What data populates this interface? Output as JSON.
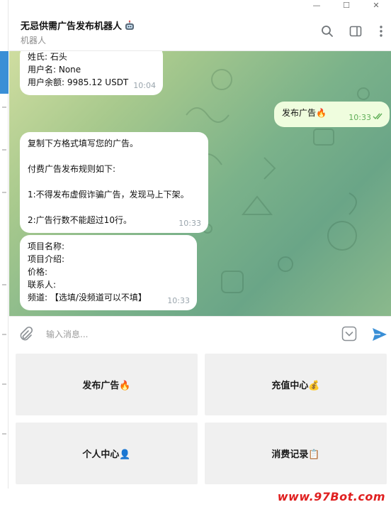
{
  "window": {
    "minimize": "—",
    "maximize": "☐",
    "close": "✕"
  },
  "header": {
    "title": "无忌供需广告发布机器人",
    "subtitle": "机器人",
    "icons": [
      "search-icon",
      "sidebar-toggle-icon",
      "more-vert-icon"
    ]
  },
  "messages": [
    {
      "dir": "in",
      "lines": [
        "姓氏: 石头",
        "用户名: None",
        "用户余额: 9985.12 USDT"
      ],
      "time": "10:04"
    },
    {
      "dir": "out",
      "lines": [
        "发布广告🔥"
      ],
      "time": "10:33"
    },
    {
      "dir": "in",
      "lines": [
        "复制下方格式填写您的广告。",
        "",
        "付费广告发布规则如下:",
        "",
        "1:不得发布虚假诈骗广告，发现马上下架。",
        "",
        "2:广告行数不能超过10行。"
      ],
      "time": "10:33"
    },
    {
      "dir": "in",
      "lines": [
        "项目名称:",
        "项目介绍:",
        "价格:",
        "联系人:",
        "频道: 【选填/没频道可以不填】"
      ],
      "time": "10:33"
    }
  ],
  "input": {
    "placeholder": "输入消息..."
  },
  "keyboard": [
    {
      "label": "发布广告🔥"
    },
    {
      "label": "充值中心💰"
    },
    {
      "label": "个人中心👤"
    },
    {
      "label": "消费记录📋"
    }
  ],
  "watermark": "www.97Bot.com",
  "colors": {
    "accent": "#3a8fd6",
    "out_bubble": "#effdde",
    "watermark": "#e02020"
  }
}
